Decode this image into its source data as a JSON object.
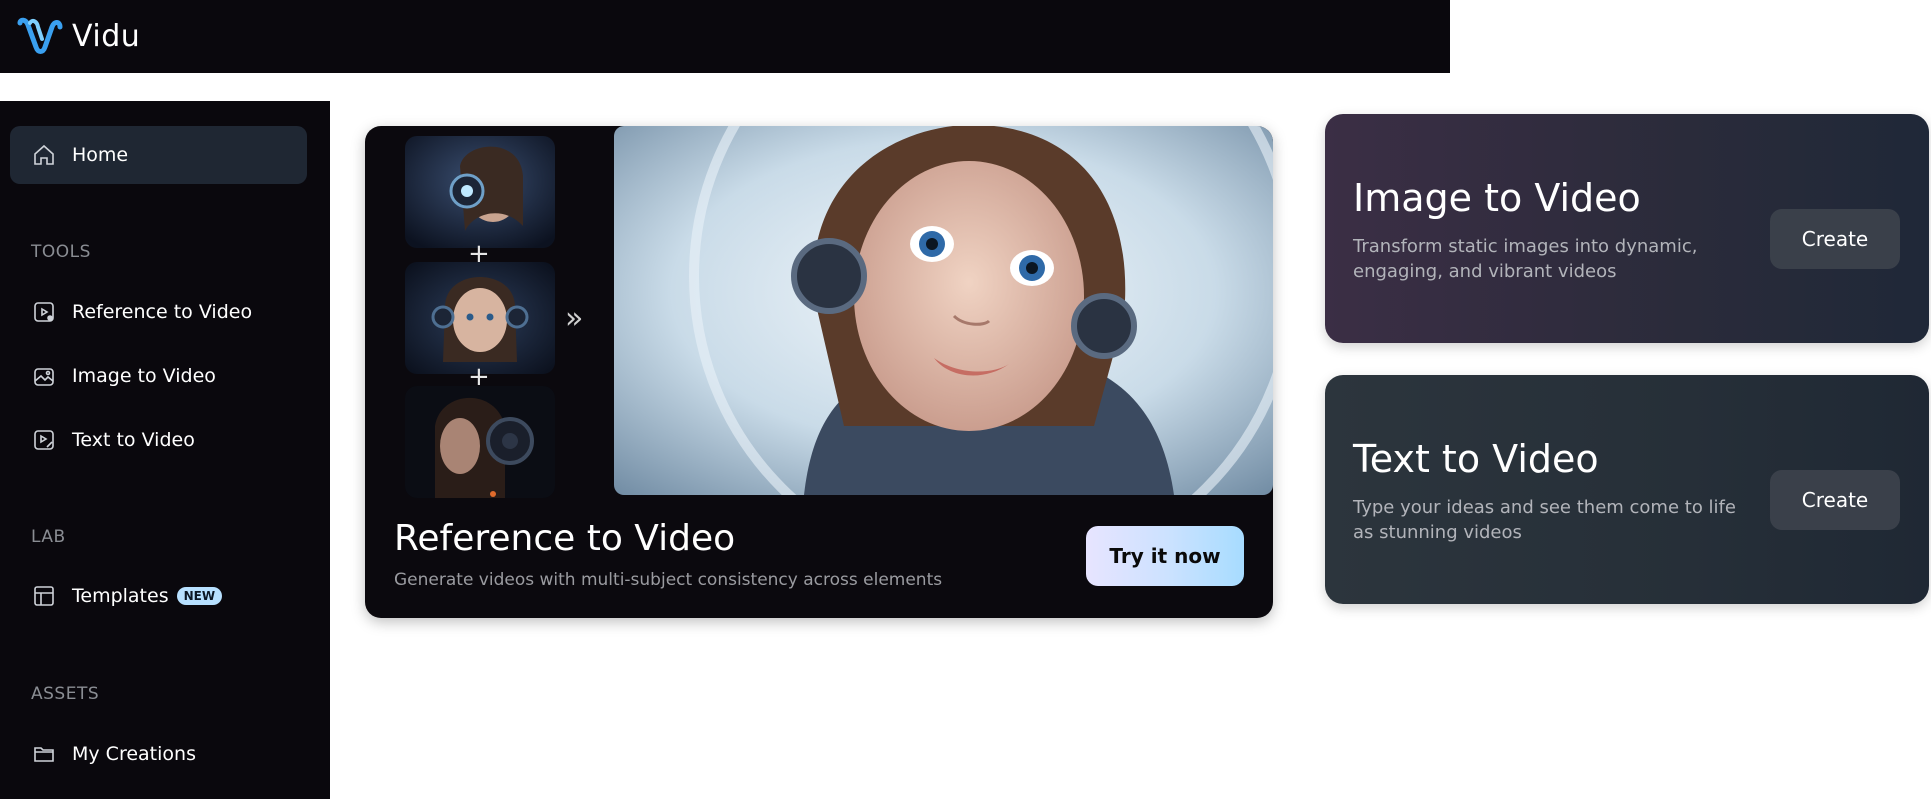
{
  "app": {
    "name": "Vidu"
  },
  "sidebar": {
    "home": {
      "label": "Home",
      "icon": "home-icon"
    },
    "sections": {
      "tools": "TOOLS",
      "lab": "LAB",
      "assets": "ASSETS"
    },
    "tools": [
      {
        "label": "Reference to Video",
        "icon": "reference-video-icon"
      },
      {
        "label": "Image to Video",
        "icon": "image-video-icon"
      },
      {
        "label": "Text to Video",
        "icon": "text-video-icon"
      }
    ],
    "lab": [
      {
        "label": "Templates",
        "badge": "NEW",
        "icon": "templates-icon"
      }
    ],
    "assets": [
      {
        "label": "My Creations",
        "icon": "folder-icon"
      }
    ]
  },
  "hero": {
    "title": "Reference to Video",
    "subtitle": "Generate videos with multi-subject consistency across elements",
    "button": "Try it now"
  },
  "cards": [
    {
      "title": "Image to Video",
      "description": "Transform static images into dynamic, engaging, and vibrant videos",
      "button": "Create"
    },
    {
      "title": "Text to Video",
      "description": "Type your ideas and see them come to life as stunning videos",
      "button": "Create"
    }
  ],
  "colors": {
    "sidebar_bg": "#0a080d",
    "active_item_bg": "#1f2733",
    "badge_bg": "#b7e0ff",
    "logo_blue": "#3aa0f0"
  }
}
